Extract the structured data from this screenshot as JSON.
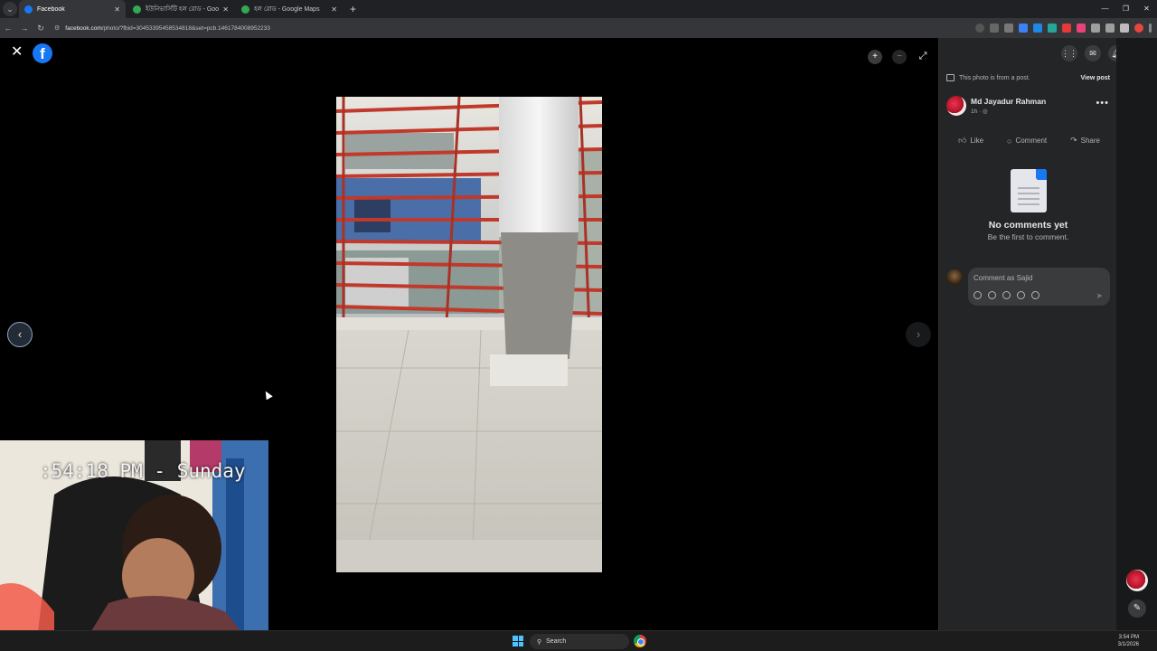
{
  "browser": {
    "tabs": [
      {
        "label": "Facebook",
        "active": true,
        "icon": "facebook-icon",
        "color": "#1877f2"
      },
      {
        "label": "ইউনিভার্সিটি হল রোড - Google",
        "active": false,
        "icon": "maps-pin-icon",
        "color": "#34a853"
      },
      {
        "label": "হল রোড - Google Maps",
        "active": false,
        "icon": "maps-pin-icon",
        "color": "#34a853"
      }
    ],
    "url_host": "facebook.com",
    "url_path": "/photo/?fbid=30453395458534818&set=pcb.1461784008952233"
  },
  "viewer": {
    "close_icon": "close-icon",
    "logo": "f",
    "webcam_clock": ":54:18 PM - Sunday"
  },
  "panel": {
    "from_post": "This photo is from a post.",
    "view_post": "View post",
    "author_name": "Md Jayadur Rahman",
    "author_time": "1h · ",
    "actions": {
      "like": "Like",
      "comment": "Comment",
      "share": "Share"
    },
    "no_comments_title": "No comments yet",
    "no_comments_sub": "Be the first to comment.",
    "comment_placeholder": "Comment as Sajid"
  },
  "taskbar": {
    "search_label": "Search",
    "time": "3:54 PM",
    "date": "3/1/2026"
  },
  "colors": {
    "accent": "#1877f2",
    "panel_bg": "#242526"
  }
}
